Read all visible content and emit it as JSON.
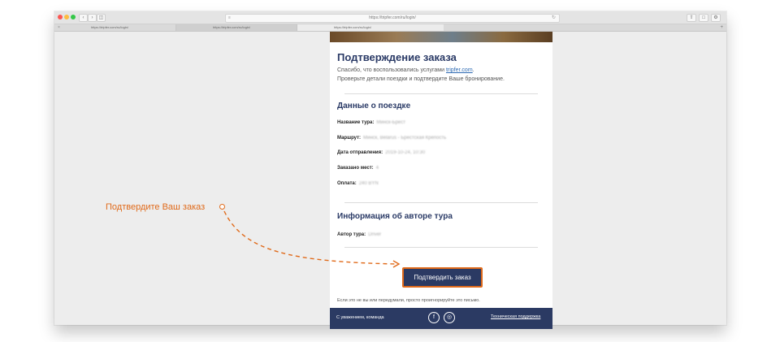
{
  "browser": {
    "address": "https://tripfer.com/ru/login/",
    "tabs": [
      {
        "label": "https://tripfer.com/ru/login/"
      },
      {
        "label": "https://tripfer.com/ru/login/"
      },
      {
        "label": "https://tripfer.com/ru/login/"
      }
    ],
    "new_tab": "+"
  },
  "email": {
    "title": "Подтверждение заказа",
    "intro_prefix": "Спасибо, что воспользовались услугами ",
    "intro_link": "tripfer.com",
    "intro_suffix": ".",
    "intro_line2": "Проверьте детали поездки и подтвердите Ваше бронирование.",
    "trip_heading": "Данные о поездке",
    "trip_rows": [
      {
        "label": "Название тура:",
        "value": "Минск-Брест"
      },
      {
        "label": "Маршрут:",
        "value": "Минск, Belarus - Брестская Крепость"
      },
      {
        "label": "Дата отправления:",
        "value": "2019-10-24, 10:30"
      },
      {
        "label": "Заказано мест:",
        "value": "4"
      },
      {
        "label": "Оплата:",
        "value": "240 BYN"
      }
    ],
    "author_heading": "Информация об авторе тура",
    "author_label": "Автор тура:",
    "author_value": "Driver",
    "confirm_button": "Подтвердить заказ",
    "note": "Если это не вы или передумали, просто проигнорируйте это письмо.",
    "footer": {
      "sign": "С уважением, команда",
      "support": "Техническая поддержка"
    }
  },
  "annotation": {
    "text": "Подтвердите Ваш заказ",
    "color": "#e06a1a"
  },
  "colors": {
    "brand_navy": "#2b3a63",
    "accent_orange": "#e06a1a",
    "link_blue": "#2d6ab3"
  }
}
